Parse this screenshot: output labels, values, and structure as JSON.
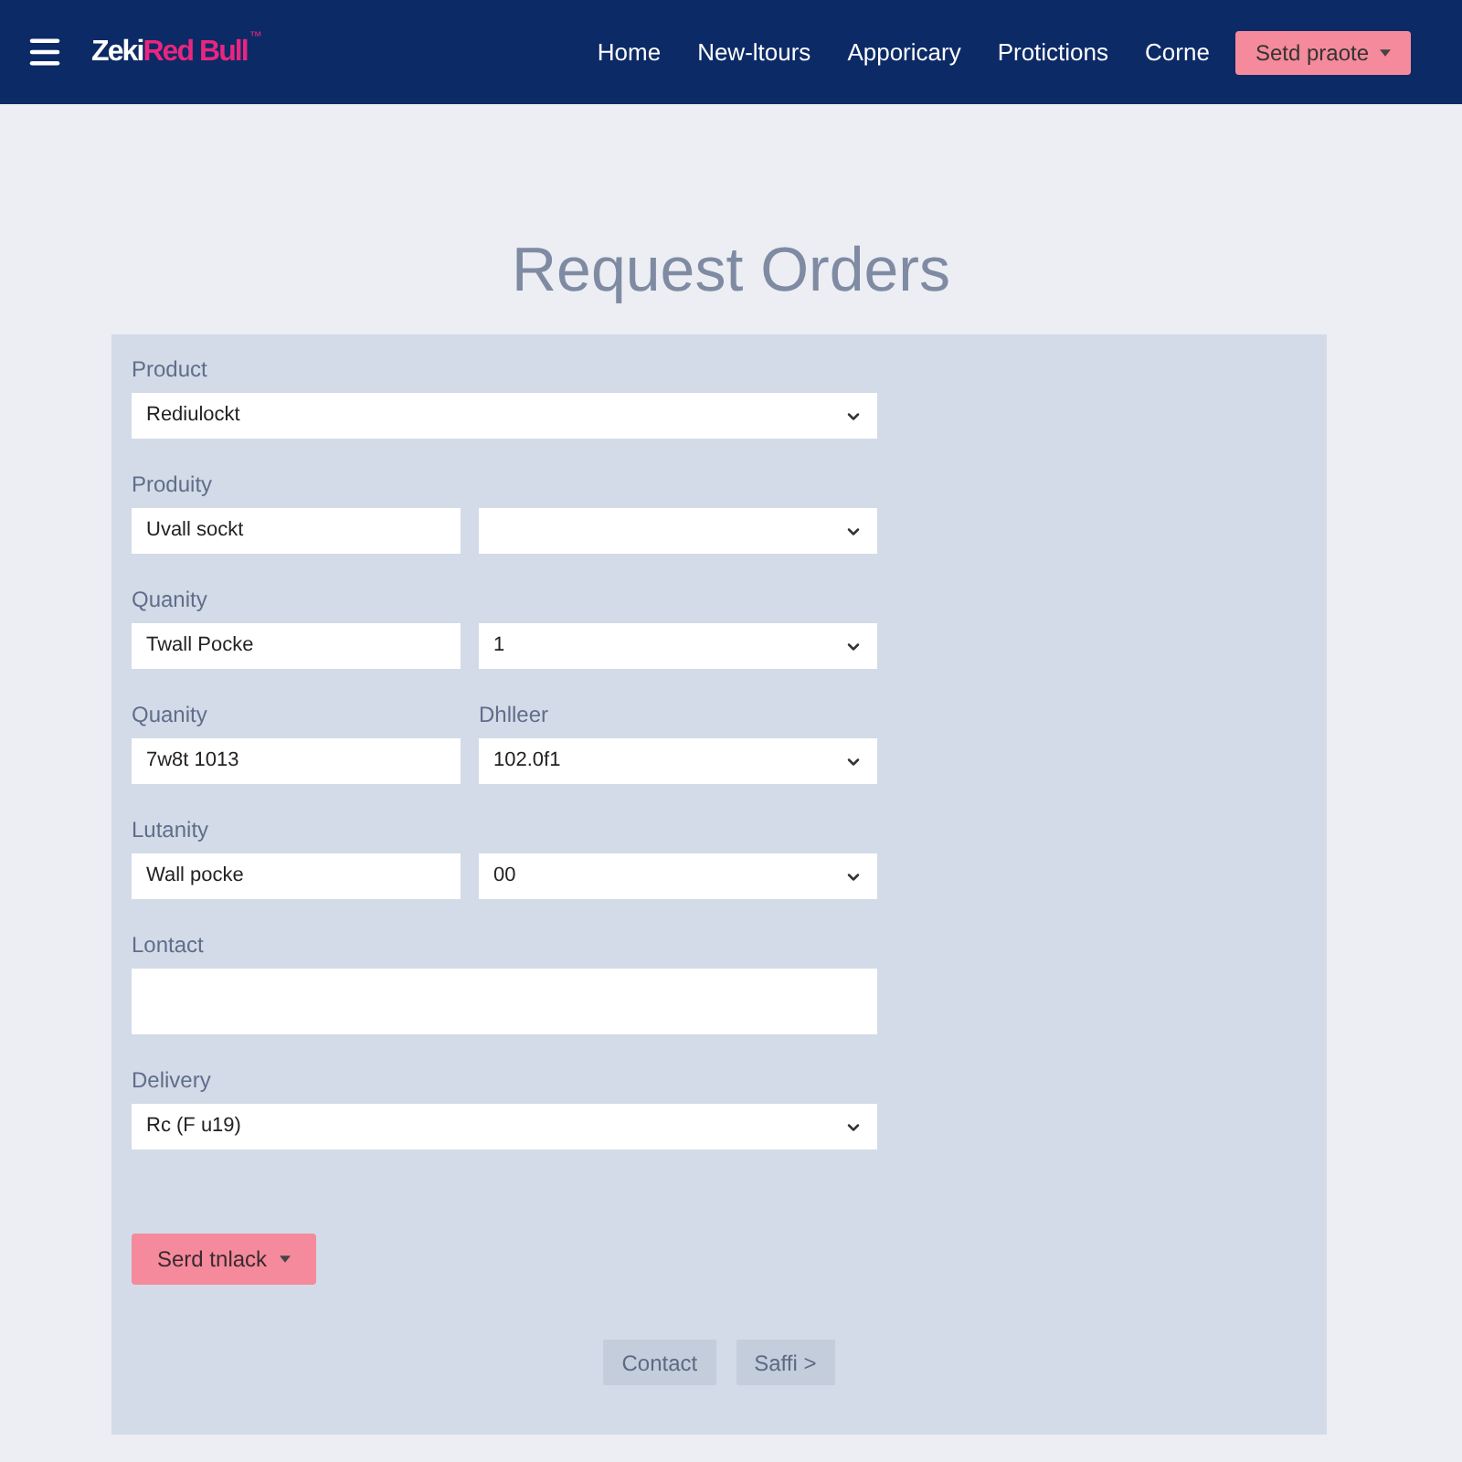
{
  "header": {
    "logo": {
      "word_1": "Zeki",
      "word_2": "Red Bull",
      "mark": "™"
    },
    "nav": [
      {
        "label": "Home"
      },
      {
        "label": "New-ltours"
      },
      {
        "label": "Apporicary"
      },
      {
        "label": "Protictions"
      },
      {
        "label": "Corne"
      }
    ],
    "action_button": {
      "label": "Setd praote"
    }
  },
  "title": "Request Orders",
  "form": {
    "rows": [
      {
        "fields": [
          {
            "kind": "select",
            "label": "Product",
            "value": "Rediulockt"
          }
        ]
      },
      {
        "fields": [
          {
            "kind": "input",
            "label": "Produity",
            "value": "Uvall sockt"
          },
          {
            "kind": "select"
          }
        ]
      },
      {
        "fields": [
          {
            "kind": "input",
            "label": "Quanity",
            "value": "Twall Pocke"
          },
          {
            "kind": "select",
            "value": "1"
          }
        ]
      },
      {
        "fields": [
          {
            "kind": "input",
            "label": "Quanity",
            "value": "7w8t 1013"
          },
          {
            "kind": "select",
            "label": "Dhlleer",
            "value": "102.0f1"
          }
        ]
      },
      {
        "fields": [
          {
            "kind": "input",
            "label": "Lutanity",
            "value": "Wall pocke"
          },
          {
            "kind": "select",
            "value": "00"
          }
        ]
      },
      {
        "fields": [
          {
            "kind": "textarea",
            "label": "Lontact"
          }
        ]
      },
      {
        "fields": [
          {
            "kind": "select",
            "label": "Delivery",
            "value": "Rc (F u19)"
          }
        ]
      }
    ],
    "submit_button": {
      "label": "Serd tnlack"
    },
    "footer_buttons": [
      {
        "label": "Contact",
        "disabled": true
      },
      {
        "label": "Saffi >",
        "disabled": true
      }
    ]
  }
}
